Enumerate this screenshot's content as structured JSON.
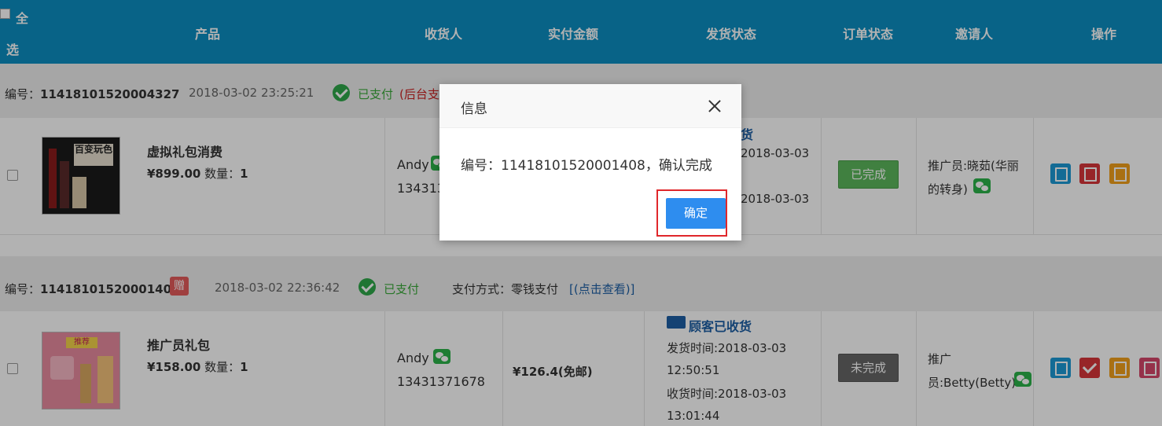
{
  "header": {
    "select_all_1": "全",
    "select_all_2": "选",
    "columns": [
      "产品",
      "收货人",
      "实付金额",
      "发货状态",
      "订单状态",
      "邀请人",
      "操作"
    ]
  },
  "orders": [
    {
      "number_label": "编号：",
      "number": "11418101520004327",
      "time": "2018-03-02 23:25:21",
      "pay_status": "已支付",
      "pay_note": "(后台支",
      "product_name": "虚拟礼包消费",
      "price": "¥899.00",
      "qty_label": "数量：",
      "qty": "1",
      "receiver": "Andy",
      "phone": "134313",
      "ship_title": "货",
      "ship_line1": "2018-03-03",
      "ship_line2": "2018-03-03",
      "order_status": "已完成",
      "inviter_1": "推广员:晓茹(华丽",
      "inviter_2": "的转身)"
    },
    {
      "number_label": "编号：",
      "number": "11418101520001408",
      "gift": "赠",
      "time": "2018-03-02 22:36:42",
      "pay_status": "已支付",
      "pay_method": "支付方式：零钱支付",
      "pay_link": "[(点击查看)]",
      "product_name": "推广员礼包",
      "price": "¥158.00",
      "qty_label": "数量：",
      "qty": "1",
      "receiver": "Andy",
      "phone": "13431371678",
      "amount": "¥126.4(免邮)",
      "ship_title": "顾客已收货",
      "ship_line1": "发货时间:2018-03-03",
      "ship_line2": "12:50:51",
      "ship_line3": "收货时间:2018-03-03",
      "ship_line4": "13:01:44",
      "order_status": "未完成",
      "inviter_1": "推广",
      "inviter_2": "员:Betty(Betty)"
    }
  ],
  "thumb1_text": "百变玩色",
  "thumb2_text": "推荐",
  "dialog": {
    "title": "信息",
    "message": "编号：11418101520001408，确认完成",
    "confirm": "确定"
  }
}
